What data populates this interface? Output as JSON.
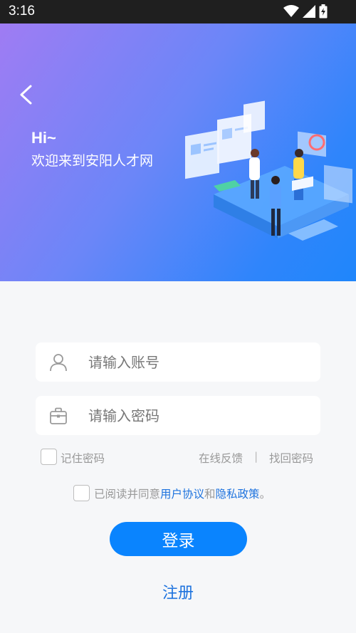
{
  "status_bar": {
    "time": "3:16"
  },
  "hero": {
    "greeting": "Hi~",
    "welcome": "欢迎来到安阳人才网",
    "back_icon": "chevron-left-icon"
  },
  "form": {
    "account_placeholder": "请输入账号",
    "password_placeholder": "请输入密码",
    "account_icon": "user-icon",
    "password_icon": "briefcase-icon"
  },
  "options": {
    "remember_password": "记住密码",
    "feedback": "在线反馈",
    "separator": "|",
    "forgot_password": "找回密码"
  },
  "agreement": {
    "prefix": "已阅读并同意",
    "user_agreement": "用户协议",
    "and": "和",
    "privacy_policy": "隐私政策",
    "suffix": "。"
  },
  "actions": {
    "login": "登录",
    "register": "注册"
  },
  "colors": {
    "primary": "#0a84fe",
    "link": "#1e73de",
    "hero_start": "#9f7cf3",
    "hero_end": "#1f86fb"
  }
}
